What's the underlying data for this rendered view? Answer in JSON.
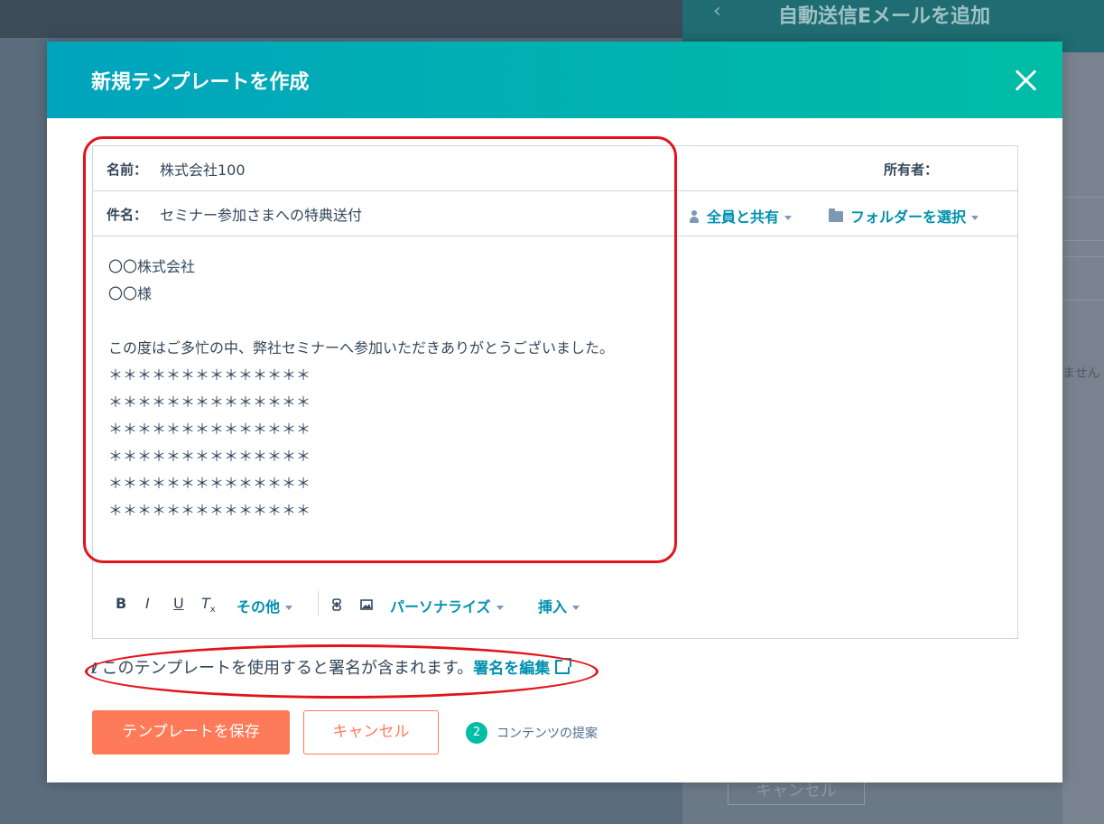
{
  "background": {
    "right_panel_title": "自動送信Eメールを追加",
    "back_icon": "chevron-left-icon",
    "right_fragment_text": "ません",
    "ghost_button_label": "キャンセル"
  },
  "modal": {
    "title": "新規テンプレートを作成",
    "close_icon": "close-icon",
    "header_gradient": [
      "#00a4bd",
      "#00bda5"
    ]
  },
  "editor": {
    "name_label": "名前：",
    "name_value": "株式会社100",
    "owner_label": "所有者：",
    "subject_label": "件名：",
    "subject_value": "セミナー参加さまへの特典送付",
    "share_label": "全員と共有",
    "folder_label": "フォルダーを選択",
    "body_lines": [
      "〇〇株式会社",
      "〇〇様",
      "",
      "この度はご多忙の中、弊社セミナーへ参加いただきありがとうございました。",
      "＊＊＊＊＊＊＊＊＊＊＊＊＊＊",
      "＊＊＊＊＊＊＊＊＊＊＊＊＊＊",
      "＊＊＊＊＊＊＊＊＊＊＊＊＊＊",
      "＊＊＊＊＊＊＊＊＊＊＊＊＊＊",
      "＊＊＊＊＊＊＊＊＊＊＊＊＊＊",
      "＊＊＊＊＊＊＊＊＊＊＊＊＊＊"
    ]
  },
  "toolbar": {
    "bold": "B",
    "italic": "I",
    "underline": "U",
    "clear_format": "T",
    "clear_format_sub": "x",
    "more": "その他",
    "personalize": "パーソナライズ",
    "insert": "挿入"
  },
  "signature": {
    "text": "このテンプレートを使用すると署名が含まれます。",
    "edit_link": "署名を編集"
  },
  "footer": {
    "save_label": "テンプレートを保存",
    "cancel_label": "キャンセル",
    "step_number": "2",
    "step_label": "コンテンツの提案"
  },
  "colors": {
    "accent": "#0091ae",
    "primary_button": "#ff7a59",
    "annotation": "#e3131b",
    "badge": "#00bda5"
  }
}
